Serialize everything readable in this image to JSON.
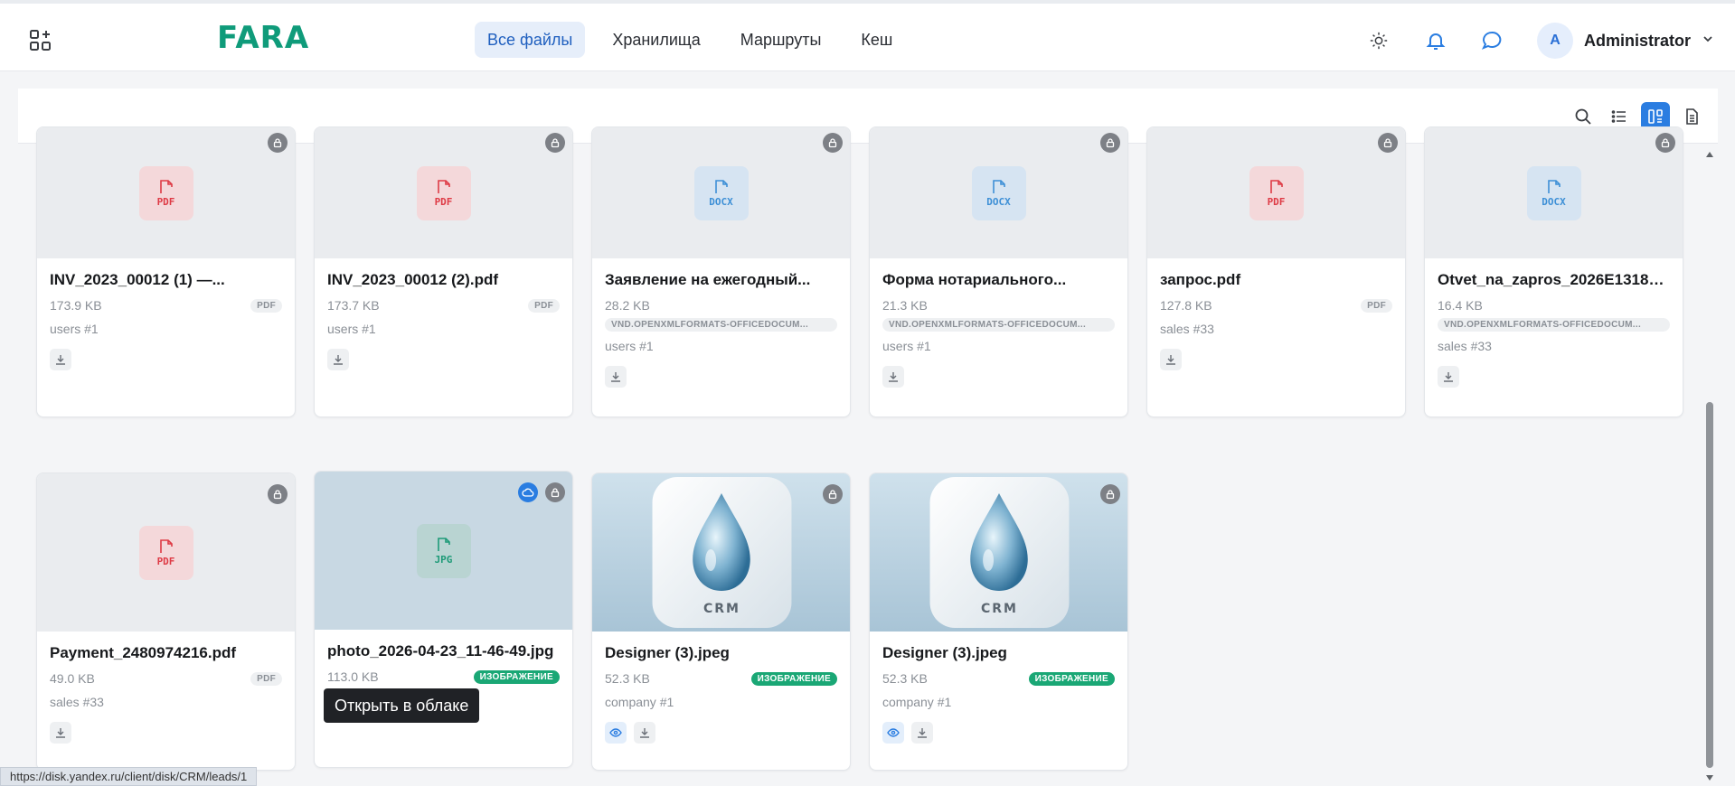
{
  "header": {
    "logo": "FARA",
    "nav": [
      {
        "label": "Все файлы",
        "active": true
      },
      {
        "label": "Хранилища",
        "active": false
      },
      {
        "label": "Маршруты",
        "active": false
      },
      {
        "label": "Кеш",
        "active": false
      }
    ],
    "user": {
      "initial": "A",
      "name": "Administrator"
    },
    "icons": [
      "apps-add-icon",
      "sun-icon",
      "bell-icon",
      "chat-icon",
      "chevron-down-icon"
    ]
  },
  "toolbar": {
    "icons": [
      "search-icon",
      "list-view-icon",
      "grid-view-icon",
      "document-view-icon"
    ],
    "active_view": "grid-view"
  },
  "files": [
    {
      "name": "INV_2023_00012 (1) —...",
      "size": "173.9 KB",
      "type": "PDF",
      "owner": "users #1",
      "ext": "PDF",
      "kind": "pdf"
    },
    {
      "name": "INV_2023_00012 (2).pdf",
      "size": "173.7 KB",
      "type": "PDF",
      "owner": "users #1",
      "ext": "PDF",
      "kind": "pdf"
    },
    {
      "name": "Заявление на ежегодный...",
      "size": "28.2 KB",
      "type": "VND.OPENXMLFORMATS-OFFICEDOCUM...",
      "owner": "users #1",
      "ext": "DOCX",
      "kind": "docx"
    },
    {
      "name": "Форма нотариального...",
      "size": "21.3 KB",
      "type": "VND.OPENXMLFORMATS-OFFICEDOCUM...",
      "owner": "users #1",
      "ext": "DOCX",
      "kind": "docx"
    },
    {
      "name": "запрос.pdf",
      "size": "127.8 KB",
      "type": "PDF",
      "owner": "sales #33",
      "ext": "PDF",
      "kind": "pdf"
    },
    {
      "name": "Otvet_na_zapros_2026E13185....",
      "size": "16.4 KB",
      "type": "VND.OPENXMLFORMATS-OFFICEDOCUM...",
      "owner": "sales #33",
      "ext": "DOCX",
      "kind": "docx"
    },
    {
      "name": "Payment_2480974216.pdf",
      "size": "49.0 KB",
      "type": "PDF",
      "owner": "sales #33",
      "ext": "PDF",
      "kind": "pdf"
    },
    {
      "name": "photo_2026-04-23_11-46-49.jpg",
      "size": "113.0 KB",
      "type": "ИЗОБРАЖЕНИЕ",
      "owner": "",
      "ext": "JPG",
      "kind": "jpg"
    },
    {
      "name": "Designer (3).jpeg",
      "size": "52.3 KB",
      "type": "ИЗОБРАЖЕНИЕ",
      "owner": "company #1",
      "ext": "CRM",
      "kind": "image"
    },
    {
      "name": "Designer (3).jpeg",
      "size": "52.3 KB",
      "type": "ИЗОБРАЖЕНИЕ",
      "owner": "company #1",
      "ext": "CRM",
      "kind": "image"
    }
  ],
  "tooltip": "Открыть в облаке",
  "status_url": "https://disk.yandex.ru/client/disk/CRM/leads/1",
  "colors": {
    "brand": "#0f9b7a",
    "accent": "#2a7de1",
    "pdf": "#de3a45",
    "docx": "#3d8fd6",
    "image_badge": "#1aa775"
  }
}
